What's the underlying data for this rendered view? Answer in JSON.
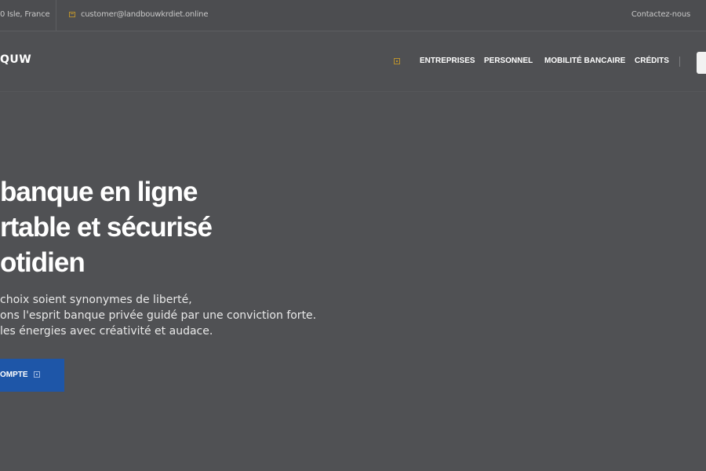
{
  "topbar": {
    "location": "0 Isle, France",
    "email": "customer@landbouwkrdiet.online",
    "contact": "Contactez-nous"
  },
  "nav": {
    "brand": "QUW",
    "links": [
      "ENTREPRISES",
      "PERSONNEL",
      "MOBILITÉ BANCAIRE",
      "CRÉDITS"
    ]
  },
  "hero": {
    "title_lines": [
      "banque en ligne",
      "rtable et sécurisé",
      "otidien"
    ],
    "text_lines": [
      "choix soient synonymes de liberté,",
      "ons l'esprit banque privée guidé par une conviction forte.",
      "les énergies avec créativité et audace."
    ],
    "button_label": "OMPTE"
  },
  "colors": {
    "background": "#505154",
    "accent_gold": "#b8902e",
    "button_blue": "#1e56a8"
  },
  "icons": {
    "mail": "mail-icon",
    "nav": "square-icon",
    "button": "arrow-icon"
  }
}
